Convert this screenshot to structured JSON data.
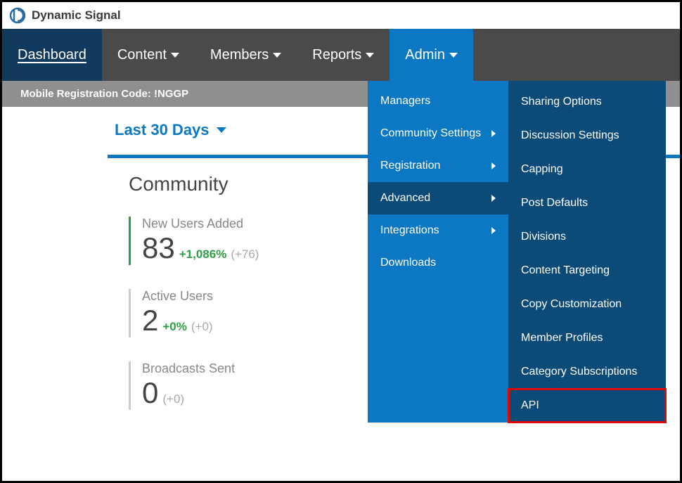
{
  "brand": {
    "name": "Dynamic Signal"
  },
  "nav": {
    "dashboard": "Dashboard",
    "content": "Content",
    "members": "Members",
    "reports": "Reports",
    "admin": "Admin"
  },
  "notice": {
    "text": "Mobile Registration Code: !NGGP"
  },
  "timerange": {
    "label": "Last 30 Days"
  },
  "panel": {
    "title": "Community",
    "metrics": [
      {
        "label": "New Users Added",
        "value": "83",
        "pct": "+1,086%",
        "abs": "(+76)",
        "highlight": true
      },
      {
        "label": "Active Users",
        "value": "2",
        "pct": "+0%",
        "abs": "(+0)",
        "highlight": false
      },
      {
        "label": "Broadcasts Sent",
        "value": "0",
        "pct": "",
        "abs": "(+0)",
        "highlight": false
      }
    ]
  },
  "admin_menu": {
    "col1": [
      {
        "label": "Managers",
        "arrow": false,
        "hovered": false
      },
      {
        "label": "Community Settings",
        "arrow": true,
        "hovered": false
      },
      {
        "label": "Registration",
        "arrow": true,
        "hovered": false
      },
      {
        "label": "Advanced",
        "arrow": true,
        "hovered": true
      },
      {
        "label": "Integrations",
        "arrow": true,
        "hovered": false
      },
      {
        "label": "Downloads",
        "arrow": false,
        "hovered": false
      }
    ],
    "col2": [
      {
        "label": "Sharing Options"
      },
      {
        "label": "Discussion Settings"
      },
      {
        "label": "Capping"
      },
      {
        "label": "Post Defaults"
      },
      {
        "label": "Divisions"
      },
      {
        "label": "Content Targeting"
      },
      {
        "label": "Copy Customization"
      },
      {
        "label": "Member Profiles"
      },
      {
        "label": "Category Subscriptions"
      },
      {
        "label": "API",
        "boxed": true
      }
    ]
  }
}
